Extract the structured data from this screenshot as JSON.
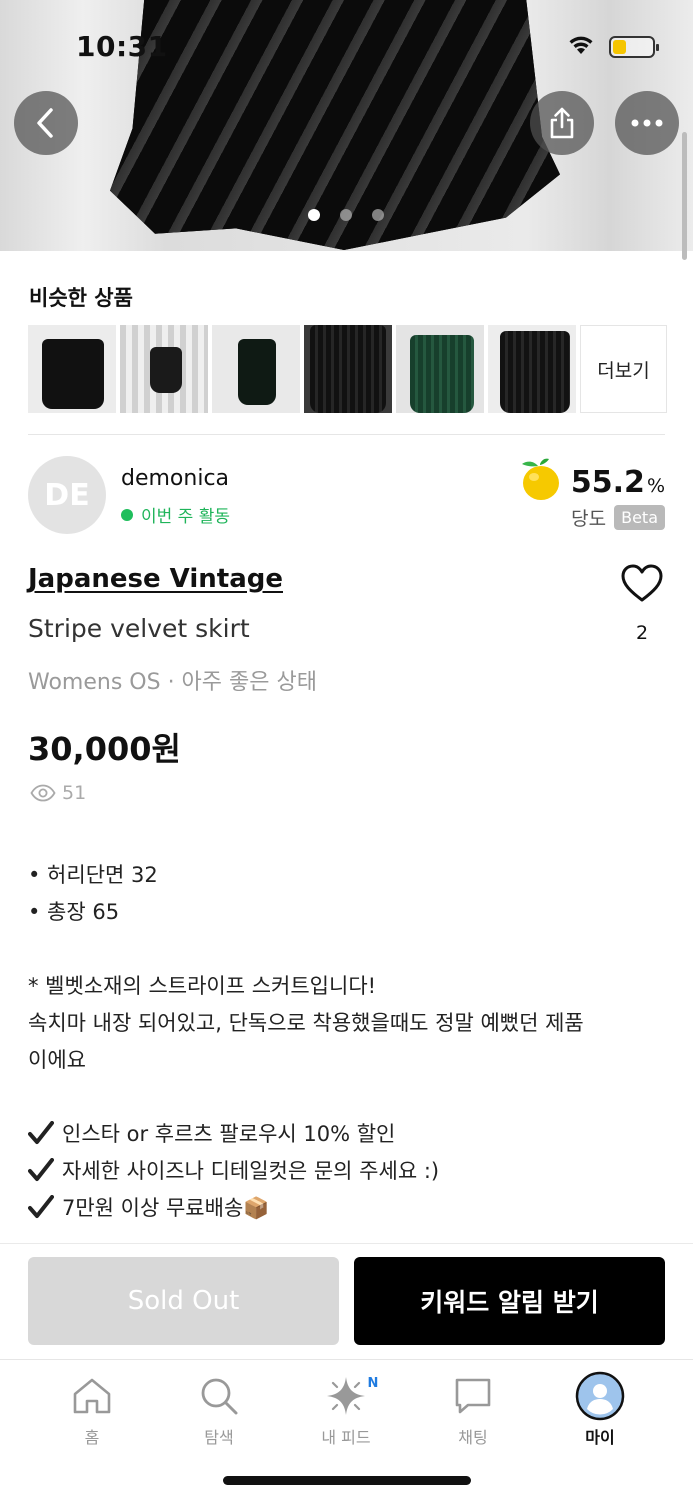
{
  "status_bar": {
    "time": "10:31",
    "battery_level": 0.3
  },
  "header": {
    "image_pager": {
      "count": 3,
      "active_index": 0
    }
  },
  "similar": {
    "title": "비슷한 상품",
    "more_label": "더보기",
    "thumbnail_colors": [
      "#111111",
      "#1a1a1a",
      "#0f1a14",
      "#151515",
      "#173f2c",
      "#121212"
    ]
  },
  "seller": {
    "avatar_initials": "DE",
    "name": "demonica",
    "activity": "이번 주 활동",
    "score_value": "55.2",
    "score_unit": "%",
    "score_label": "당도",
    "score_badge": "Beta"
  },
  "product": {
    "brand": "Japanese Vintage",
    "title": "Stripe velvet skirt",
    "meta": "Womens OS · 아주 좋은 상태",
    "price": "30,000원",
    "views": "51",
    "likes": "2"
  },
  "description": {
    "measurements": [
      "• 허리단면 32",
      "• 총장 65"
    ],
    "lines": [
      "* 벨벳소재의 스트라이프 스커트입니다!",
      "속치마 내장 되어있고, 단독으로 착용했을때도 정말 예뻤던 제품",
      "이에요"
    ],
    "checks": [
      "인스타 or 후르츠 팔로우시 10% 할인",
      "자세한 사이즈나 디테일컷은 문의 주세요 :)",
      "7만원 이상 무료배송📦"
    ]
  },
  "actions": {
    "soldout_label": "Sold Out",
    "keyword_label": "키워드 알림 받기"
  },
  "tabbar": {
    "items": [
      {
        "label": "홈"
      },
      {
        "label": "탐색"
      },
      {
        "label": "내 피드",
        "badge": "N"
      },
      {
        "label": "채팅"
      },
      {
        "label": "마이"
      }
    ]
  },
  "colors": {
    "accent_green": "#1fbe5c",
    "badge_blue": "#1f7be0",
    "soldout_gray": "#d8d8d8"
  }
}
